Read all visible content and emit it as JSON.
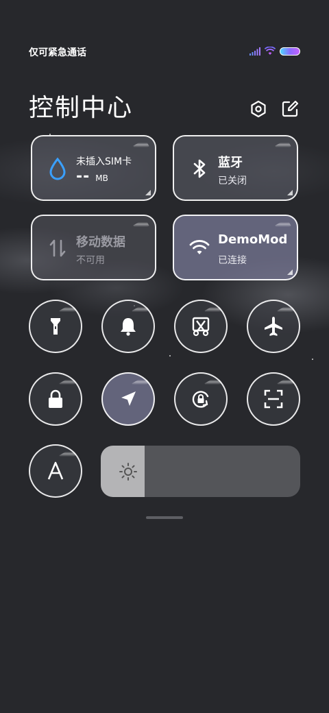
{
  "status_bar": {
    "carrier_text": "仅可紧急通话"
  },
  "header": {
    "title": "控制中心"
  },
  "icons": {
    "settings": "settings-icon",
    "edit": "edit-icon"
  },
  "tiles": {
    "data_usage": {
      "title": "未插入SIM卡",
      "value": "--",
      "unit": "MB"
    },
    "bluetooth": {
      "title": "蓝牙",
      "status": "已关闭"
    },
    "mobile_data": {
      "title": "移动数据",
      "status": "不可用"
    },
    "wifi": {
      "title": "DemoMod",
      "status": "已连接"
    }
  },
  "toggles": [
    {
      "name": "flashlight",
      "active": false
    },
    {
      "name": "mute",
      "active": false
    },
    {
      "name": "screenshot",
      "active": false
    },
    {
      "name": "airplane-mode",
      "active": false
    },
    {
      "name": "lock-screen",
      "active": false
    },
    {
      "name": "location",
      "active": true
    },
    {
      "name": "rotation-lock",
      "active": false
    },
    {
      "name": "scanner",
      "active": false
    },
    {
      "name": "auto-brightness",
      "active": false
    }
  ],
  "brightness": {
    "level": 0.22
  },
  "colors": {
    "background": "#27282c",
    "active_tile": "#78789a",
    "data_drop": "#3aa0ff"
  }
}
